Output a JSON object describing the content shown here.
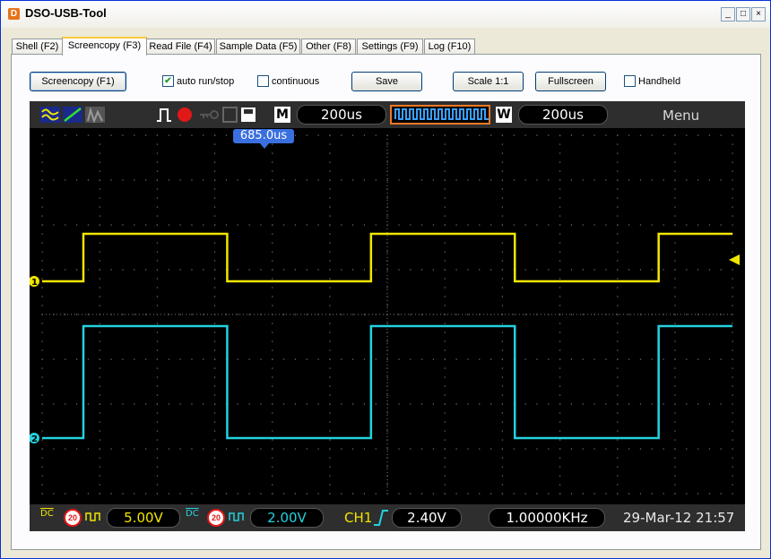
{
  "window": {
    "title": "DSO-USB-Tool",
    "app_icon_letter": "D",
    "controls": [
      "_",
      "□",
      "×"
    ]
  },
  "tabs": [
    {
      "label": "Shell (F2)",
      "active": false
    },
    {
      "label": "Screencopy (F3)",
      "active": true
    },
    {
      "label": "Read File (F4)",
      "active": false
    },
    {
      "label": "Sample Data (F5)",
      "active": false
    },
    {
      "label": "Other (F8)",
      "active": false
    },
    {
      "label": "Settings (F9)",
      "active": false
    },
    {
      "label": "Log (F10)",
      "active": false
    }
  ],
  "toolbar": {
    "screencopy_label": "Screencopy (F1)",
    "auto_run_label": "auto run/stop",
    "auto_run_checked": true,
    "continuous_label": "continuous",
    "continuous_checked": false,
    "save_label": "Save",
    "scale_label": "Scale 1:1",
    "fullscreen_label": "Fullscreen",
    "handheld_label": "Handheld",
    "handheld_checked": false
  },
  "scope": {
    "mode_badge": "M",
    "timebase": "200us",
    "window_badge": "W",
    "window_timebase": "200us",
    "menu_label": "Menu",
    "trigger_position": "685.0us",
    "ch1_marker": "1",
    "ch2_marker": "2",
    "ch1_coupling": "DC",
    "ch1_bw": "20",
    "ch1_volts": "5.00V",
    "ch2_coupling": "DC",
    "ch2_bw": "20",
    "ch2_volts": "2.00V",
    "trigger_source": "CH1",
    "trigger_level": "2.40V",
    "frequency": "1.00000KHz",
    "datetime": "29-Mar-12 21:57",
    "colors": {
      "ch1": "#F2E600",
      "ch2": "#22D2DE",
      "grid": "#8A8A8A",
      "trigger_pos_bg": "#3A6FE0",
      "record": "#E01818"
    }
  }
}
